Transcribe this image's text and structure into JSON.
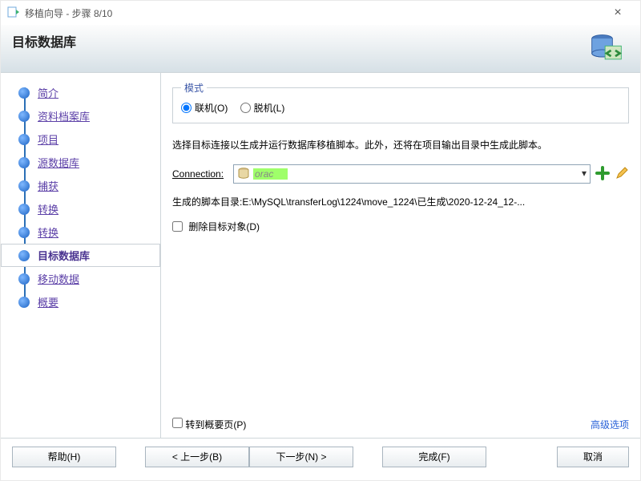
{
  "window": {
    "title": "移植向导 - 步骤 8/10"
  },
  "header": {
    "title": "目标数据库"
  },
  "steps": [
    {
      "label": "简介"
    },
    {
      "label": "资料档案库"
    },
    {
      "label": "项目"
    },
    {
      "label": "源数据库"
    },
    {
      "label": "捕获 "
    },
    {
      "label": "转换"
    },
    {
      "label": "转换"
    },
    {
      "label": "目标数据库",
      "current": true
    },
    {
      "label": "移动数据"
    },
    {
      "label": "概要"
    }
  ],
  "mode": {
    "legend": "模式",
    "online": "联机(O)",
    "offline": "脱机(L)"
  },
  "description": "选择目标连接以生成并运行数据库移植脚本。此外，还将在项目输出目录中生成此脚本。",
  "connection": {
    "label": "Connection:",
    "value": "orac"
  },
  "scriptPath": {
    "label": "生成的脚本目录:",
    "value": "E:\\MySQL\\transferLog\\1224\\move_1224\\已生成\\2020-12-24_12-..."
  },
  "deleteTarget": "删除目标对象(D)",
  "goSummary": "转到概要页(P)",
  "advanced": "高级选项",
  "buttons": {
    "help": "帮助(H)",
    "back": "< 上一步(B)",
    "next": "下一步(N) >",
    "finish": "完成(F)",
    "cancel": "取消"
  }
}
